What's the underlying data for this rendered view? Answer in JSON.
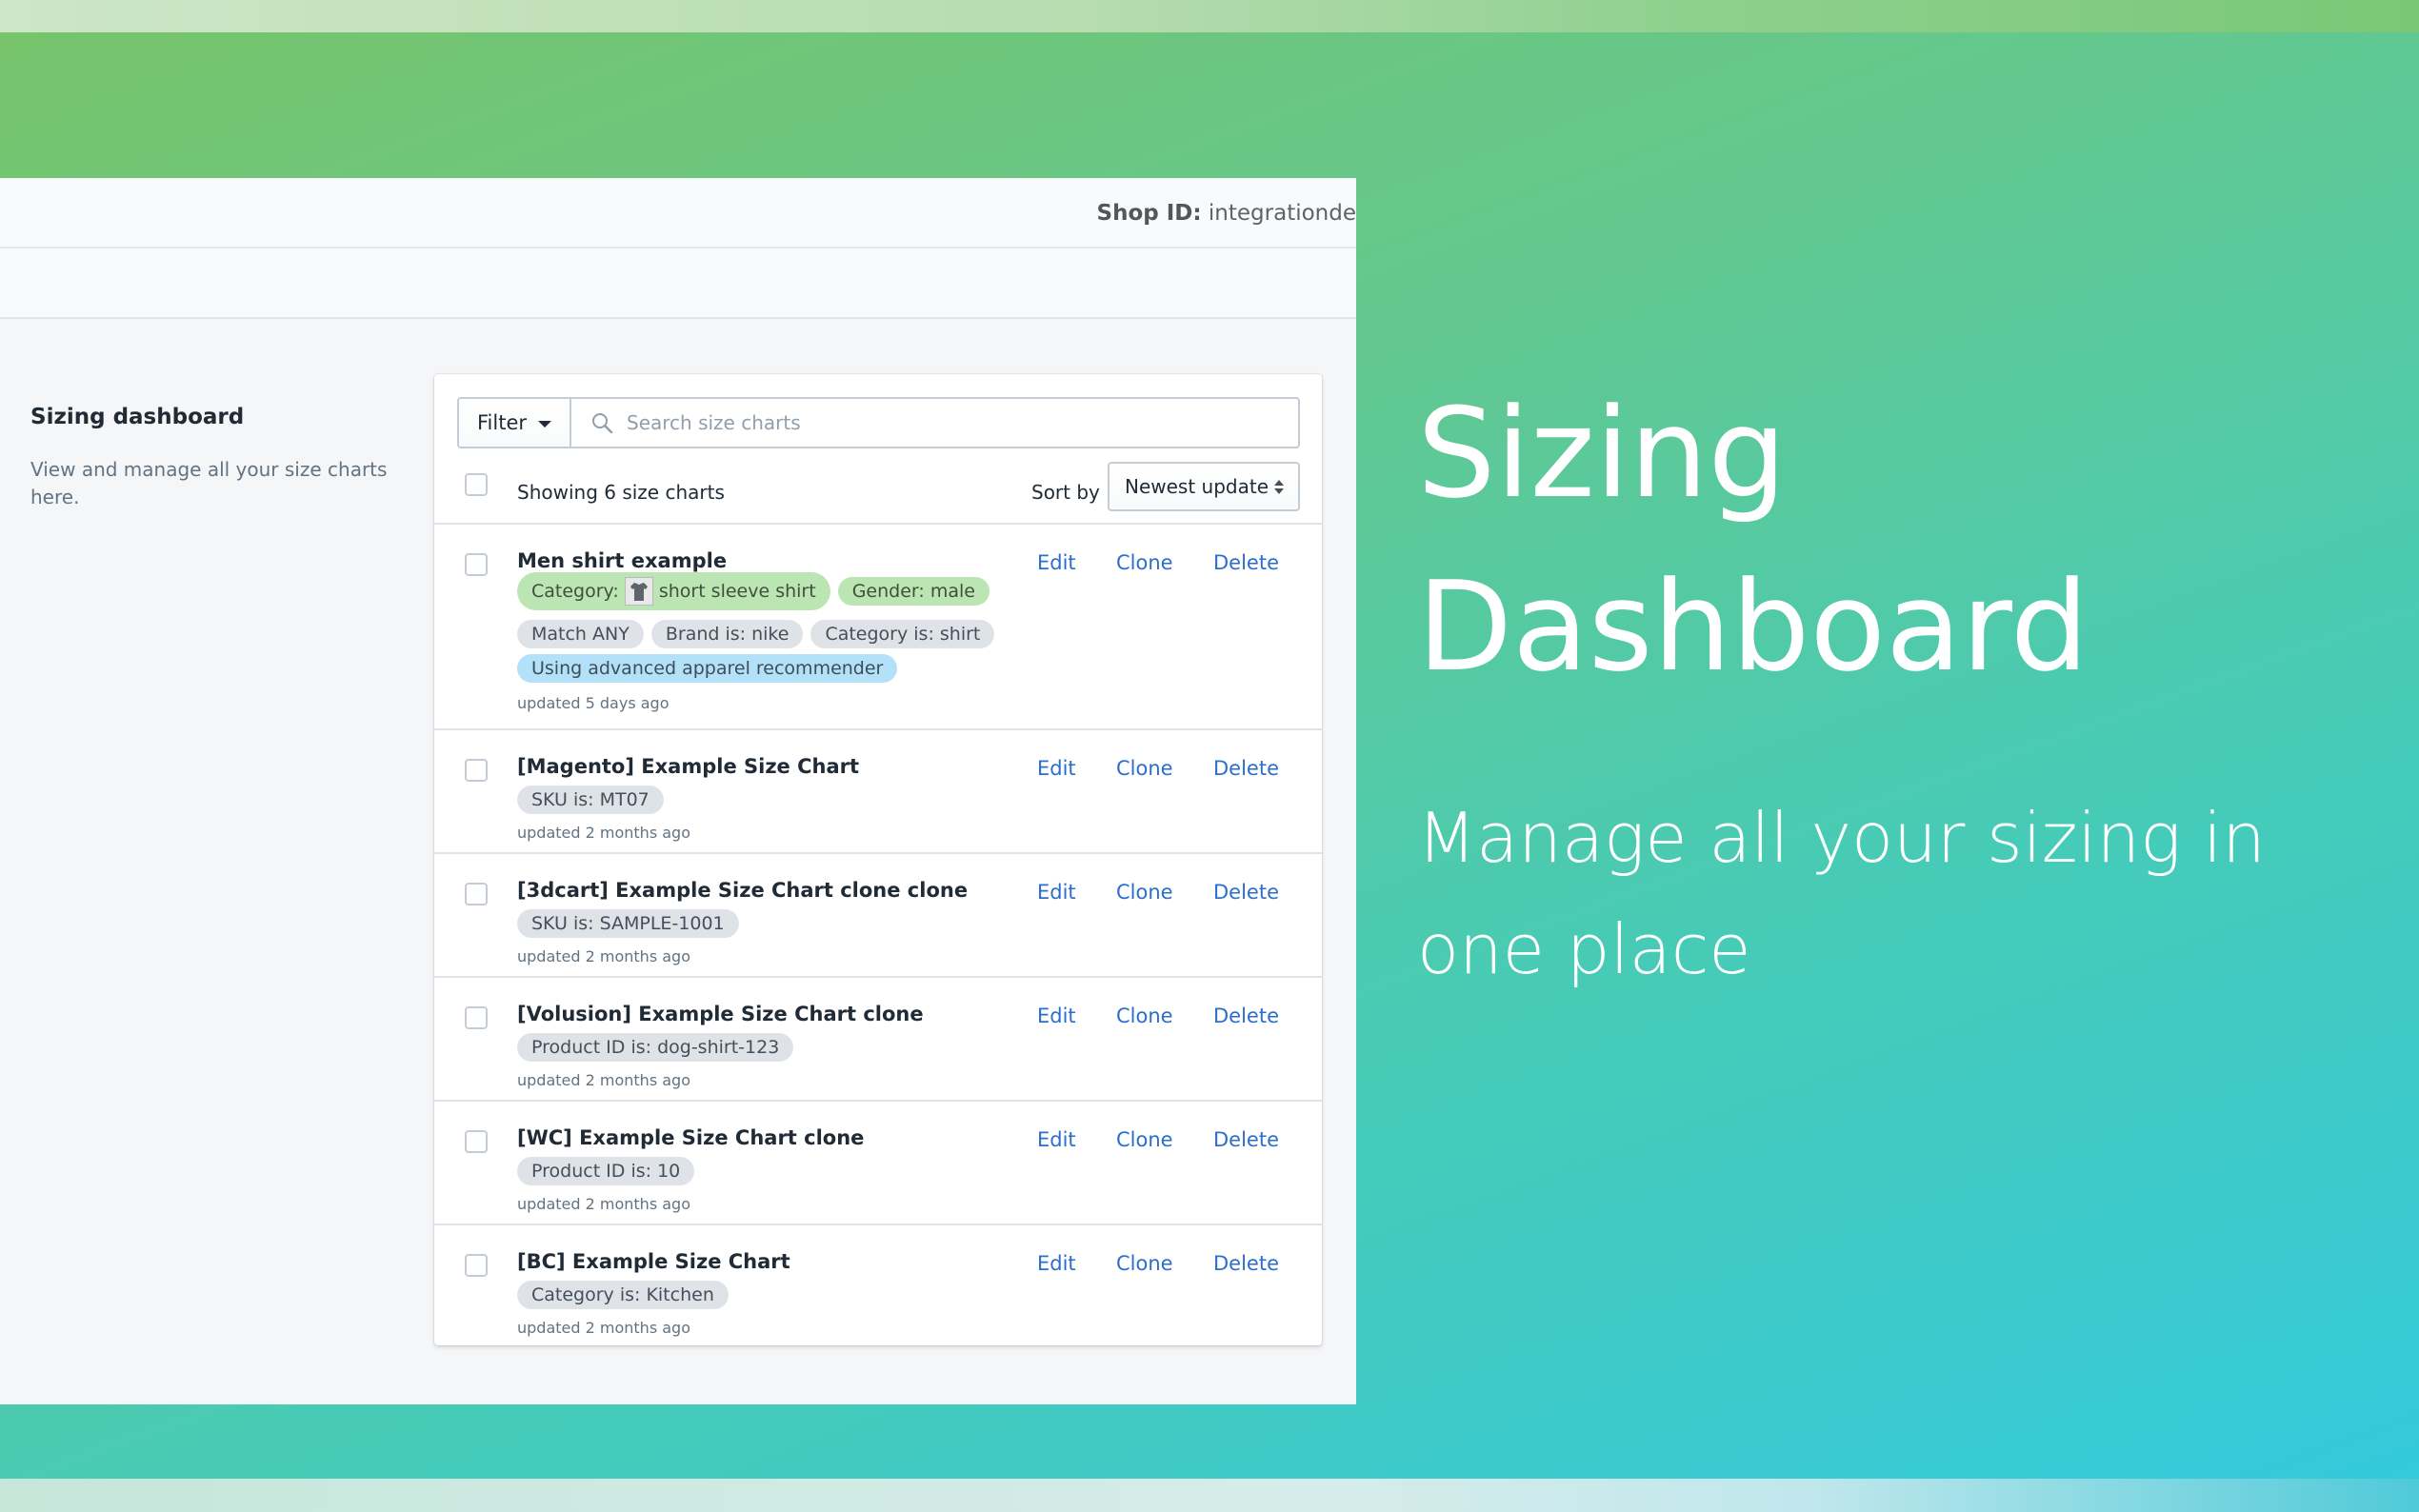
{
  "colors": {
    "accent_link": "#2c6ecb",
    "background_gradient_start": "#78c46a",
    "background_gradient_end": "#33c9dd",
    "tag_green": "#bbe5b3",
    "tag_blue": "#b4e1fa",
    "tag_gray": "#dfe3e8"
  },
  "header": {
    "shop_id_label": "Shop ID:",
    "shop_id_value": "integrationde"
  },
  "sidebar": {
    "title": "Sizing dashboard",
    "description": "View and manage all your size charts here."
  },
  "toolbar": {
    "filter_label": "Filter",
    "search_placeholder": "Search size charts",
    "search_value": ""
  },
  "list_header": {
    "count_text": "Showing 6 size charts",
    "sort_label": "Sort by",
    "sort_value": "Newest update"
  },
  "actions": {
    "edit": "Edit",
    "clone": "Clone",
    "delete": "Delete"
  },
  "rows": [
    {
      "title": "Men shirt example",
      "tags_line1": [
        "Category:",
        "short sleeve shirt",
        "Gender: male"
      ],
      "tags_line2": [
        "Match ANY",
        "Brand is: nike",
        "Category is: shirt"
      ],
      "tags_line3": [
        "Using advanced apparel recommender"
      ],
      "updated": "updated 5 days ago"
    },
    {
      "title": "[Magento] Example Size Chart",
      "tag": "SKU is: MT07",
      "updated": "updated 2 months ago"
    },
    {
      "title": "[3dcart] Example Size Chart clone clone",
      "tag": "SKU is: SAMPLE-1001",
      "updated": "updated 2 months ago"
    },
    {
      "title": "[Volusion] Example Size Chart clone",
      "tag": "Product ID is: dog-shirt-123",
      "updated": "updated 2 months ago"
    },
    {
      "title": "[WC] Example Size Chart clone",
      "tag": "Product ID is: 10",
      "updated": "updated 2 months ago"
    },
    {
      "title": "[BC] Example Size Chart",
      "tag": "Category is: Kitchen",
      "updated": "updated 2 months ago"
    }
  ],
  "hero": {
    "title_line1": "Sizing",
    "title_line2": "Dashboard",
    "subtitle": "Manage all your sizing in one place"
  }
}
